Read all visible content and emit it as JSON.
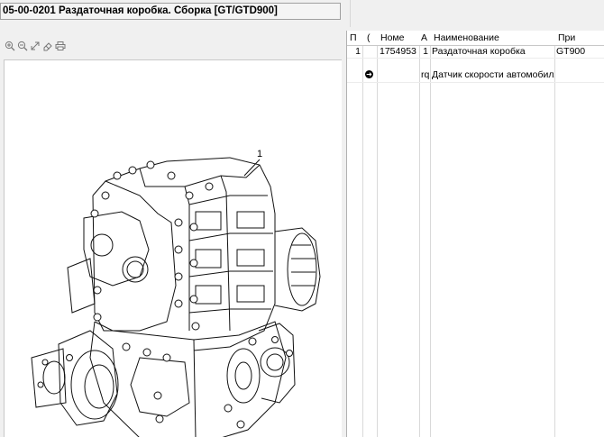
{
  "window": {
    "title": "05-00-0201 Раздаточная коробка. Сборка [GT/GTD900]"
  },
  "toolbar": {
    "icons": [
      "zoom-in-icon",
      "zoom-out-icon",
      "fit-icon",
      "eraser-icon",
      "print-icon"
    ]
  },
  "drawing": {
    "callout_number": "1"
  },
  "table": {
    "headers": {
      "pos": "П",
      "flag": "(",
      "number": "Номе",
      "qty": "А",
      "name": "Наименование",
      "note": "При"
    },
    "rows": [
      {
        "pos": "1",
        "number": "1754953",
        "qty": "1",
        "name": "Раздаточная коробка",
        "note": "GT900"
      },
      {
        "pos": "",
        "number": "",
        "qty": "rq",
        "name": "Датчик скорости автомобиля",
        "note": ""
      }
    ]
  }
}
